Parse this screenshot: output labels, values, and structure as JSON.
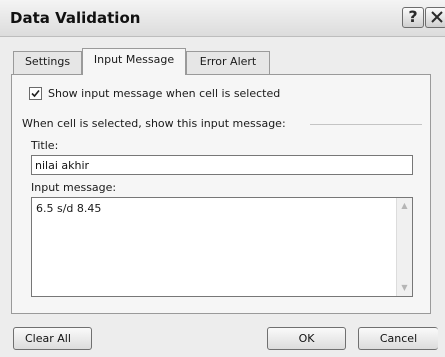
{
  "window": {
    "title": "Data Validation",
    "help_label": "?"
  },
  "tabs": [
    {
      "label": "Settings"
    },
    {
      "label": "Input Message"
    },
    {
      "label": "Error Alert"
    }
  ],
  "input_message_tab": {
    "show_checkbox": {
      "label": "Show input message when cell is selected",
      "checked": true
    },
    "group_label": "When cell is selected, show this input message:",
    "title_label": "Title:",
    "title_value": "nilai akhir",
    "message_label": "Input message:",
    "message_value": "6.5 s/d 8.45"
  },
  "buttons": {
    "clear_all": "Clear All",
    "ok": "OK",
    "cancel": "Cancel"
  }
}
